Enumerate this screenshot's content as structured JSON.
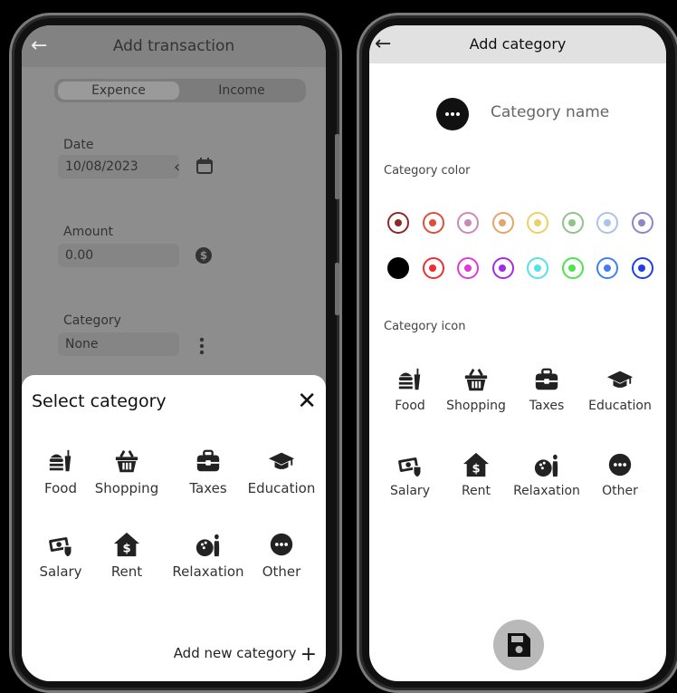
{
  "left": {
    "header": {
      "title": "Add transaction"
    },
    "tabs": [
      "Expence",
      "Income"
    ],
    "fields": {
      "date": {
        "label": "Date",
        "value": "10/08/2023"
      },
      "amount": {
        "label": "Amount",
        "value": "0.00"
      },
      "category": {
        "label": "Category",
        "value": "None"
      }
    },
    "sheet": {
      "title": "Select category",
      "categories": [
        {
          "label": "Food",
          "icon": "food-icon"
        },
        {
          "label": "Shopping",
          "icon": "shopping-basket-icon"
        },
        {
          "label": "Taxes",
          "icon": "briefcase-icon"
        },
        {
          "label": "Education",
          "icon": "graduation-cap-icon"
        },
        {
          "label": "Salary",
          "icon": "salary-icon"
        },
        {
          "label": "Rent",
          "icon": "house-dollar-icon"
        },
        {
          "label": "Relaxation",
          "icon": "bowling-icon"
        },
        {
          "label": "Other",
          "icon": "more-dots-icon"
        }
      ],
      "add_new": "Add new category"
    }
  },
  "right": {
    "header": {
      "title": "Add category"
    },
    "name_placeholder": "Category name",
    "color_label": "Category color",
    "colors_row1": [
      "#8b2a2a",
      "#d9503f",
      "#c98ab8",
      "#e3a56a",
      "#e8d26a",
      "#8fc48a",
      "#a9c3ea",
      "#8b86c6"
    ],
    "colors_row2": [
      "#000000",
      "#ef2f2f",
      "#e03ad6",
      "#a22ce0",
      "#53e2e6",
      "#4ce34c",
      "#3f7ff0",
      "#1f3fe6"
    ],
    "icon_label": "Category icon",
    "categories": [
      {
        "label": "Food",
        "icon": "food-icon"
      },
      {
        "label": "Shopping",
        "icon": "shopping-basket-icon"
      },
      {
        "label": "Taxes",
        "icon": "briefcase-icon"
      },
      {
        "label": "Education",
        "icon": "graduation-cap-icon"
      },
      {
        "label": "Salary",
        "icon": "salary-icon"
      },
      {
        "label": "Rent",
        "icon": "house-dollar-icon"
      },
      {
        "label": "Relaxation",
        "icon": "bowling-icon"
      },
      {
        "label": "Other",
        "icon": "more-dots-icon"
      }
    ]
  }
}
